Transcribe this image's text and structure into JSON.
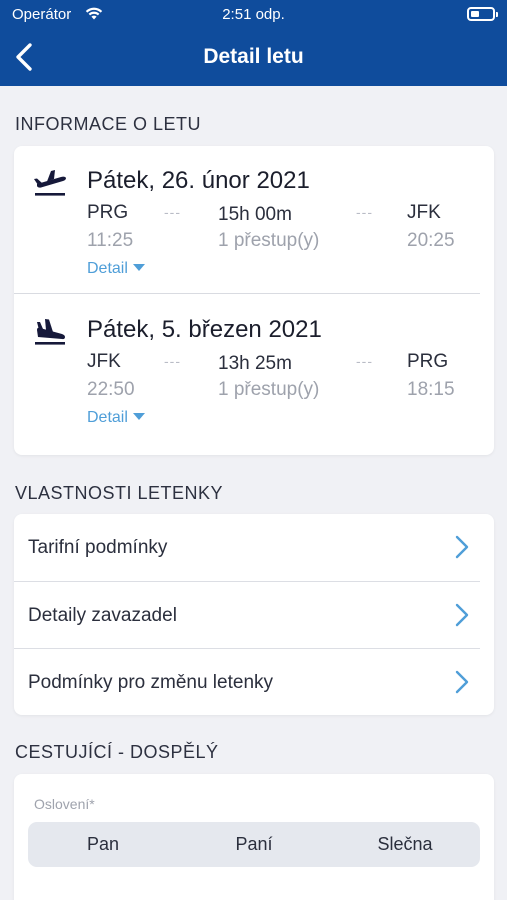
{
  "status_bar": {
    "carrier": "Operátor",
    "time": "2:51 odp."
  },
  "header": {
    "title": "Detail letu"
  },
  "sections": {
    "flight_info": "INFORMACE O LETU",
    "ticket_properties": "VLASTNOSTI LETENKY",
    "passenger": "CESTUJÍCÍ - DOSPĚLÝ"
  },
  "flights": [
    {
      "direction": "departure",
      "date": "Pátek, 26. únor 2021",
      "from": "PRG",
      "to": "JFK",
      "duration": "15h 00m",
      "departure_time": "11:25",
      "arrival_time": "20:25",
      "stops": "1 přestup(y)",
      "detail_label": "Detail",
      "separator": "---"
    },
    {
      "direction": "arrival",
      "date": "Pátek, 5. březen 2021",
      "from": "JFK",
      "to": "PRG",
      "duration": "13h 25m",
      "departure_time": "22:50",
      "arrival_time": "18:15",
      "stops": "1 přestup(y)",
      "detail_label": "Detail",
      "separator": "---"
    }
  ],
  "ticket_properties": [
    {
      "label": "Tarifní podmínky"
    },
    {
      "label": "Detaily zavazadel"
    },
    {
      "label": "Podmínky pro změnu letenky"
    }
  ],
  "passenger_form": {
    "salutation_label": "Oslovení*",
    "salutation_options": [
      "Pan",
      "Paní",
      "Slečna"
    ]
  },
  "colors": {
    "primary": "#0f4c9c",
    "accent": "#4f9ed8",
    "background": "#f0f1f5"
  },
  "icons": [
    "wifi-icon",
    "battery-icon",
    "back-arrow-icon",
    "plane-departure-icon",
    "plane-arrival-icon",
    "chevron-right-icon",
    "caret-down-icon"
  ]
}
